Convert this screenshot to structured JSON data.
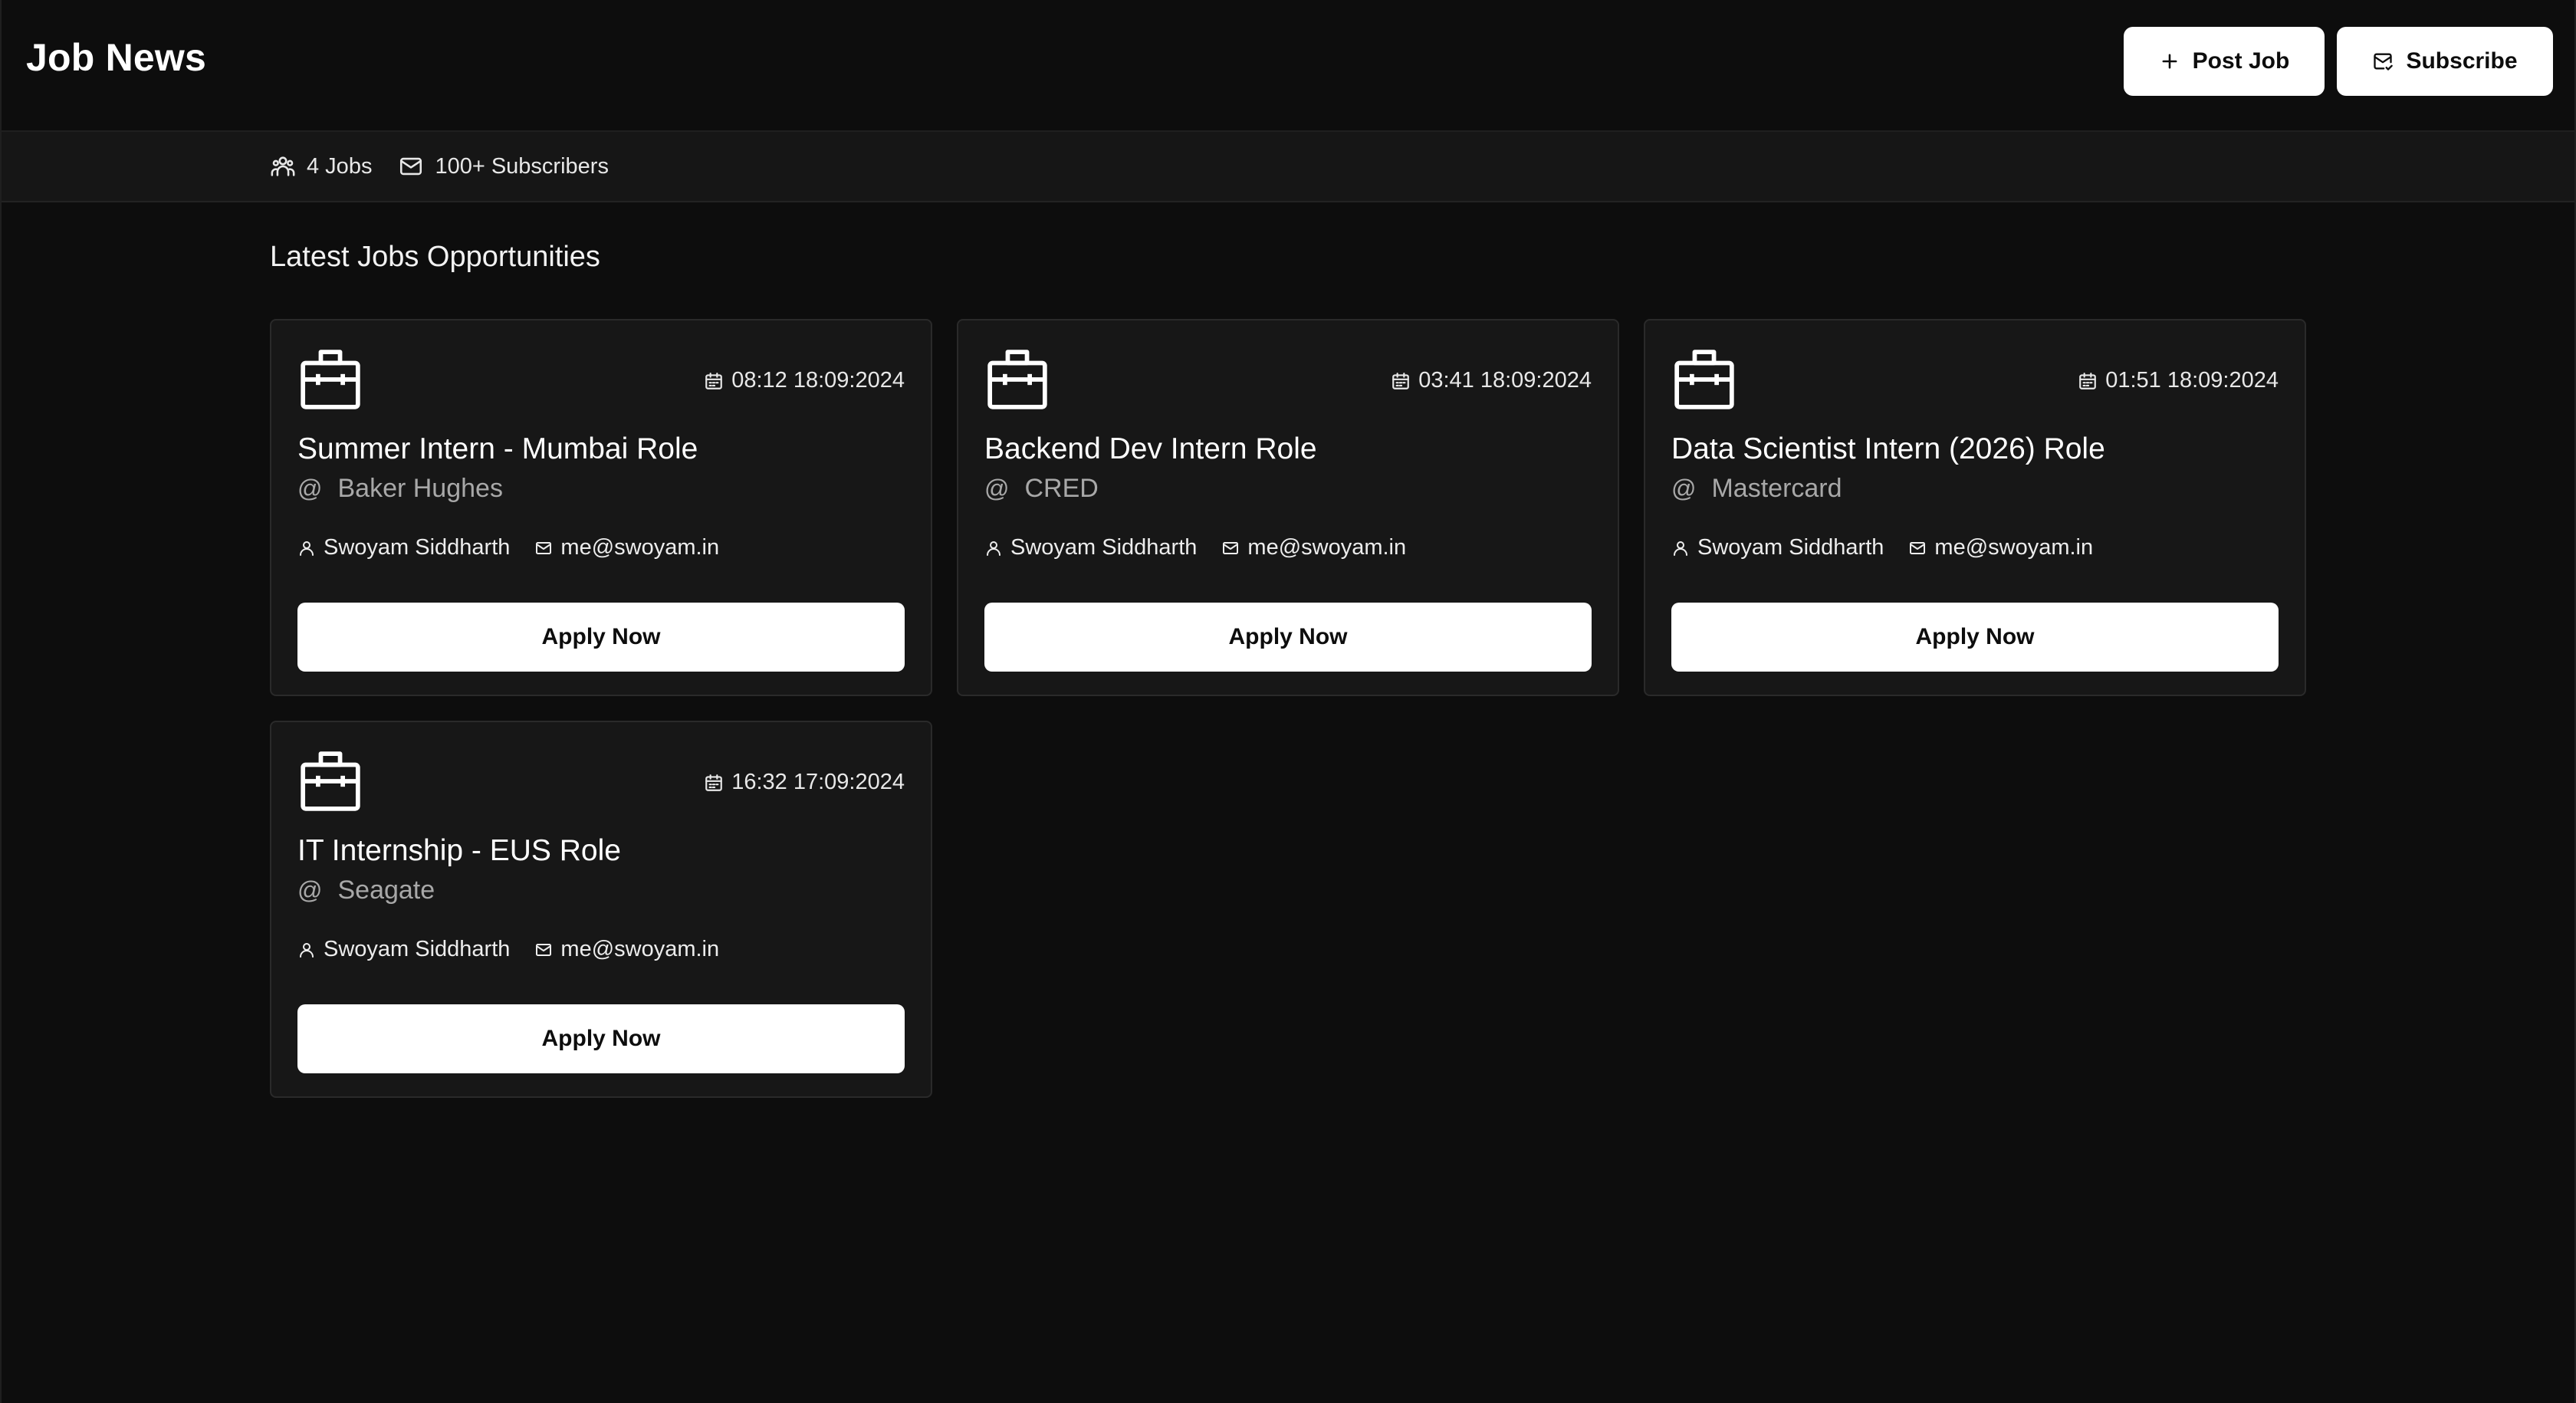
{
  "header": {
    "title": "Job News",
    "post_job_label": "Post Job",
    "subscribe_label": "Subscribe"
  },
  "stats": {
    "jobs": "4 Jobs",
    "subscribers": "100+ Subscribers"
  },
  "section": {
    "title": "Latest Jobs Opportunities"
  },
  "jobs": [
    {
      "date": "08:12 18:09:2024",
      "title": "Summer Intern - Mumbai Role",
      "company": "Baker Hughes",
      "poster": "Swoyam Siddharth",
      "email": "me@swoyam.in",
      "apply_label": "Apply Now"
    },
    {
      "date": "03:41 18:09:2024",
      "title": "Backend Dev Intern Role",
      "company": "CRED",
      "poster": "Swoyam Siddharth",
      "email": "me@swoyam.in",
      "apply_label": "Apply Now"
    },
    {
      "date": "01:51 18:09:2024",
      "title": "Data Scientist Intern (2026) Role",
      "company": "Mastercard",
      "poster": "Swoyam Siddharth",
      "email": "me@swoyam.in",
      "apply_label": "Apply Now"
    },
    {
      "date": "16:32 17:09:2024",
      "title": "IT Internship - EUS Role",
      "company": "Seagate",
      "poster": "Swoyam Siddharth",
      "email": "me@swoyam.in",
      "apply_label": "Apply Now"
    }
  ],
  "icons": {
    "post_job": "plus-icon",
    "subscribe": "mail-icon",
    "jobs_stat": "users-icon",
    "subscribers_stat": "mail-icon",
    "job_card": "briefcase-icon",
    "date": "calendar-icon",
    "poster": "user-icon",
    "email": "mail-icon"
  },
  "colors": {
    "background": "#0d0d0d",
    "statsbar": "#161616",
    "card": "#171717",
    "button": "#ffffff",
    "muted_text": "#a8a8a8"
  }
}
